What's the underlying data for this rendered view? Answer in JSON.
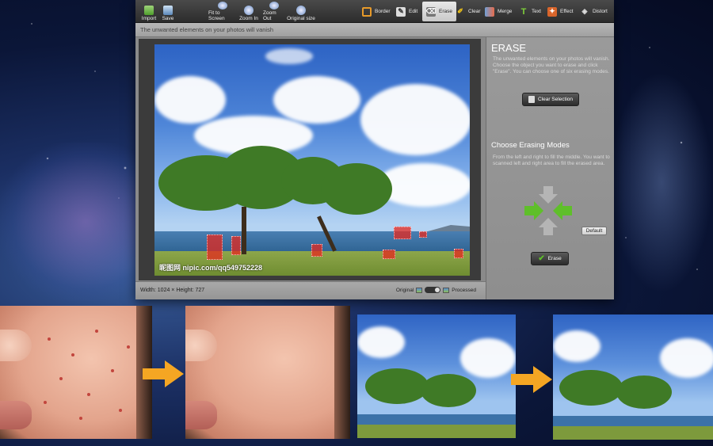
{
  "toolbar": {
    "buttons": [
      {
        "label": "Import",
        "icon": "import-icon"
      },
      {
        "label": "Save",
        "icon": "save-icon"
      },
      {
        "label": "Fit to Screen",
        "icon": "fit-screen-icon"
      },
      {
        "label": "Zoom In",
        "icon": "zoom-in-icon"
      },
      {
        "label": "Zoom Out",
        "icon": "zoom-out-icon"
      },
      {
        "label": "Original size",
        "icon": "original-size-icon"
      }
    ],
    "tools": [
      {
        "label": "Border",
        "icon": "border-icon"
      },
      {
        "label": "Edit",
        "icon": "edit-icon"
      },
      {
        "label": "Erase",
        "icon": "eraser-icon",
        "active": true
      },
      {
        "label": "Clear",
        "icon": "brush-icon"
      },
      {
        "label": "Merge",
        "icon": "merge-icon"
      },
      {
        "label": "Text",
        "icon": "text-icon"
      },
      {
        "label": "Effect",
        "icon": "effect-icon"
      },
      {
        "label": "Distort",
        "icon": "distort-icon"
      }
    ]
  },
  "subbar": {
    "message": "The unwanted elements on your photos will vanish"
  },
  "photo": {
    "watermark": "昵图网 nipic.com/qq549752228"
  },
  "status": {
    "dimensions": "Width: 1024 × Height: 727",
    "original_label": "Original",
    "processed_label": "Processed"
  },
  "side": {
    "title": "ERASE",
    "intro": "The unwanted elements on your photos will vanish. Choose the object you want to erase and click \"Erase\". You can choose one of six erasing modes.",
    "clear_selection": "Clear Selection",
    "modes_heading": "Choose Erasing Modes",
    "modes_text": "From the left and right to fill the middle. You want to scanned left and right area to fill the erased area.",
    "default_button": "Default",
    "erase_button": "Erase"
  },
  "colors": {
    "accent_green": "#5fbf2a",
    "mark_red": "#e6281e",
    "arrow_orange": "#f5a623"
  }
}
